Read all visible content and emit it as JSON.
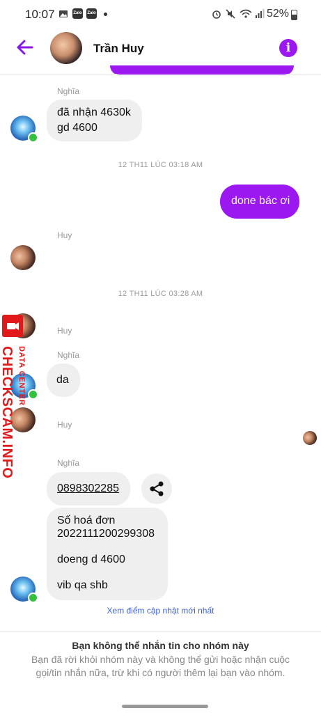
{
  "status_bar": {
    "time": "10:07",
    "notif_icons": [
      "image-icon",
      "zalo-icon",
      "zalo-icon"
    ],
    "zalo_label": "Zalo",
    "battery": "52%"
  },
  "header": {
    "title": "Trần Huy",
    "back_icon": "arrow-left-icon",
    "info_icon": "info-icon",
    "info_glyph": "i"
  },
  "messages": {
    "m1_sender": "Nghĩa",
    "m1_text": "đã nhận 4630k\ngd 4600",
    "ts1": "12 TH11 LÚC 03:18 AM",
    "m2_text": "done bác ơi",
    "m3_sender": "Huy",
    "ts2": "12 TH11 LÚC 03:28 AM",
    "m4_sender": "Huy",
    "m5_sender": "Nghĩa",
    "m5_text": "da",
    "m6_sender": "Huy",
    "m7_sender": "Nghĩa",
    "m7_phone": "0898302285",
    "m8_text": "Số hoá đơn\n2022111200299308\n\ndoeng d 4600\n\nvib qa shb",
    "update_link": "Xem điểm cập nhật mới nhất"
  },
  "footer": {
    "title": "Bạn không thể nhắn tin cho nhóm này",
    "desc": "Bạn đã rời khỏi nhóm này và không thể gửi hoặc nhận cuộc gọi/tin nhắn nữa, trừ khi có người thêm lại bạn vào nhóm."
  },
  "watermark": {
    "main": "CHECKSCAM.INFO",
    "sub": "DATA CENTER"
  },
  "colors": {
    "accent": "#9b18f0",
    "online": "#36c040",
    "watermark": "#e0191a"
  }
}
